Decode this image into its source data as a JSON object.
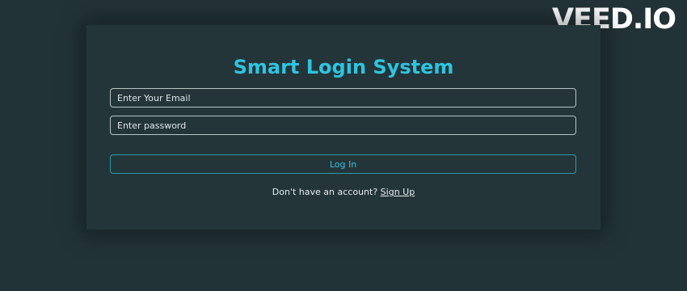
{
  "watermark": "VEED.IO",
  "login_card": {
    "title": "Smart Login System",
    "email_placeholder": "Enter Your Email",
    "password_placeholder": "Enter password",
    "login_label": "Log In",
    "signup_prompt": "Don't have an account?",
    "signup_link": "Sign Up"
  },
  "colors": {
    "background": "#223338",
    "card": "#243539",
    "accent": "#2ec4e0",
    "text": "#e7eced"
  }
}
